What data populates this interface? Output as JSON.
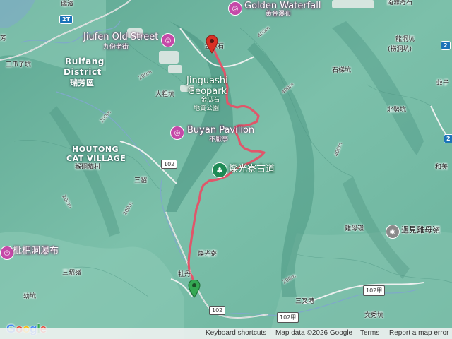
{
  "map": {
    "colors": {
      "terrain_base": "#6fb7a3",
      "track": "#e0566a",
      "water": "#7fa9c9",
      "road": "#f2f2f2"
    },
    "labels": {
      "golden_waterfall_en": "Golden Waterfall",
      "golden_waterfall_zh": "黃金瀑布",
      "jiufen_en": "Jiufen Old Street",
      "jiufen_zh": "九份老街",
      "jinguashi_en_1": "Jinguashi",
      "jinguashi_en_2": "Geopark",
      "jinguashi_zh_1": "金瓜石",
      "jinguashi_zh_2": "地質公園",
      "jinguashi_top": "金瓜石",
      "buyan_en": "Buyan Pavilion",
      "buyan_zh": "不厭亭",
      "canguang_trail": "燦光寮古道",
      "houtong_en_1": "HOUTONG",
      "houtong_en_2": "CAT VILLAGE",
      "houtong_zh": "猴硐貓村",
      "ruifang_en_1": "Ruifang",
      "ruifang_en_2": "District",
      "ruifang_zh": "瑞芳區",
      "pipadong_zh": "枇杷洞瀑布",
      "jimu_zh": "遇見雞母嶺",
      "ruibin": "瑞濱",
      "nanya": "南雅奇石",
      "sanzhuazikeng": "三爪子坑",
      "dacukeng": "大粗坑",
      "sandiao": "三貂",
      "sandiaoling": "三貂嶺",
      "youkeng": "幼坑",
      "canguangliao": "燦光寮",
      "mudan": "牡丹",
      "longdongkeng_1": "龍洞坑",
      "longdongkeng_2": "(撈洞坑)",
      "shitikeng": "石梯坑",
      "beishikeng": "北勢坑",
      "jimuling": "雞母嶺",
      "sanchagang": "三叉港",
      "wenxiukeng": "文秀坑",
      "heimei": "和美",
      "zi": "蚊子",
      "fang": "芳"
    },
    "contours": [
      "200m",
      "400m",
      "200m",
      "400m",
      "200m",
      "200m",
      "400m",
      "200m"
    ],
    "shields": {
      "r2t": "2T",
      "r102_a": "102",
      "r102_b": "102",
      "r102jia_a": "102甲",
      "r102jia_b": "102甲",
      "r2_a": "2",
      "r2_b": "2"
    }
  },
  "footer": {
    "shortcuts": "Keyboard shortcuts",
    "mapdata": "Map data ©2026 Google",
    "terms": "Terms",
    "report": "Report a map error"
  },
  "logo": {
    "text": "Google"
  }
}
